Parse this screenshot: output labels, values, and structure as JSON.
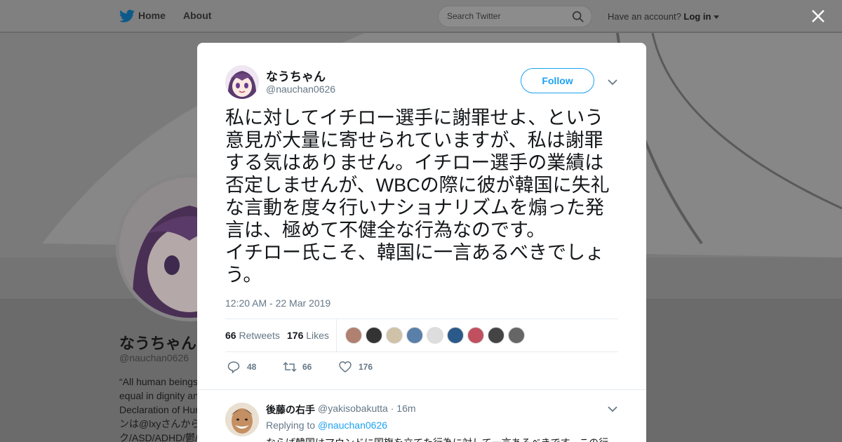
{
  "topbar": {
    "home_label": "Home",
    "about_label": "About",
    "search_placeholder": "Search Twitter",
    "account_prompt": "Have an account?",
    "login_label": "Log in"
  },
  "profile": {
    "name": "なうちゃん",
    "handle": "@nauchan0626",
    "bio_lines": [
      "“All human beings",
      "equal in dignity an",
      "Declaration of Hum",
      "ンは@lxyさんから",
      "ク/ASD/ADHD/鬱/"
    ]
  },
  "tweet": {
    "author_name": "なうちゃん",
    "author_handle": "@nauchan0626",
    "follow_label": "Follow",
    "text": "私に対してイチロー選手に謝罪せよ、という意見が大量に寄せられていますが、私は謝罪する気はありません。イチロー選手の業績は否定しませんが、WBCの際に彼が韓国に失礼な言動を度々行いナショナリズムを煽った発言は、極めて不健全な行為なのです。\nイチロー氏こそ、韓国に一言あるべきでしょう。",
    "timestamp": "12:20 AM - 22 Mar 2019",
    "retweets_count": "66",
    "retweets_label": "Retweets",
    "likes_count": "176",
    "likes_label": "Likes",
    "liker_avatar_count": 9,
    "reply_action_count": "48",
    "retweet_action_count": "66",
    "like_action_count": "176"
  },
  "reply": {
    "author_name": "後藤の右手",
    "author_handle": "@yakisobakutta",
    "age": "16m",
    "replying_prefix": "Replying to",
    "replying_to": "@nauchan0626",
    "text": "ならば韓国はマウンドに国旗を立てた行為に対して一言あるべきです。この行"
  },
  "colors": {
    "twitter_blue": "#1da1f2",
    "text_primary": "#14171a",
    "text_secondary": "#657786",
    "divider": "#e6ecf0"
  },
  "icons": [
    "twitter-bird-icon",
    "search-icon",
    "caret-down-icon",
    "close-icon",
    "chevron-down-icon",
    "reply-icon",
    "retweet-icon",
    "heart-icon"
  ]
}
